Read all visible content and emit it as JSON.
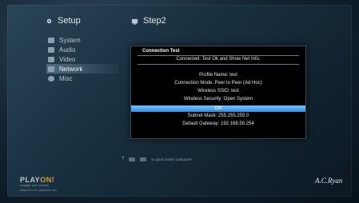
{
  "header": {
    "left_title": "Setup",
    "left_icon": "setup-gear-icon",
    "right_title": "Step2",
    "right_icon": "network-step-icon"
  },
  "sidebar": {
    "items": [
      {
        "label": "System",
        "icon": "system-icon",
        "active": false
      },
      {
        "label": "Audio",
        "icon": "audio-icon",
        "active": false
      },
      {
        "label": "Video",
        "icon": "video-icon",
        "active": false
      },
      {
        "label": "Network",
        "icon": "network-icon",
        "active": true
      },
      {
        "label": "Misc",
        "icon": "misc-icon",
        "active": false
      }
    ]
  },
  "dialog": {
    "title": "Connection Test",
    "status": "Connected: Test Ok and Show Net Info.",
    "profile_name": "Profile Name: test",
    "connection_mode": "Connection Mode: Peer to Peer (Ad Hoc)",
    "wireless_ssid": "Wireless SSID: test",
    "wireless_security": "Wireless Security: Open System",
    "ok_label": "OK",
    "subnet_mask": "Subnet Mask: 255.255.255.0",
    "default_gateway": "Default Gateway: 192.168.59.254"
  },
  "hint": {
    "question": "?",
    "text": "to quick switch categories"
  },
  "brand": {
    "left_logo_a": "PLAY",
    "left_logo_b": "ON!",
    "left_tagline": "engage your senses",
    "left_url": "playonhd.com | playonhd.com",
    "right_logo": "A.C.Ryan"
  },
  "colors": {
    "accent": "#3a95e8",
    "logo_highlight": "#d3a332"
  }
}
